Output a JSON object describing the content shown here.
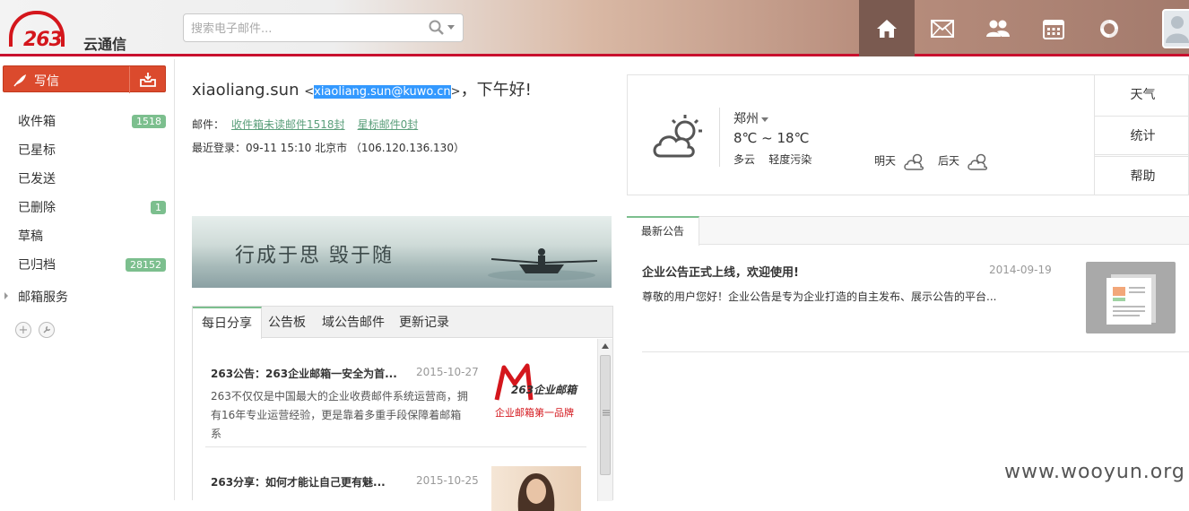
{
  "app": {
    "logo_number": "263",
    "logo_text": "云通信"
  },
  "search": {
    "placeholder": "搜索电子邮件..."
  },
  "nav": [
    {
      "icon": "home-icon",
      "active": true
    },
    {
      "icon": "mail-icon"
    },
    {
      "icon": "contacts-icon"
    },
    {
      "icon": "calendar-icon"
    },
    {
      "icon": "refresh-icon"
    }
  ],
  "sidebar": {
    "compose_label": "写信",
    "folders": [
      {
        "name": "收件箱",
        "badge": "1518"
      },
      {
        "name": "已星标",
        "badge": ""
      },
      {
        "name": "已发送",
        "badge": ""
      },
      {
        "name": "已删除",
        "badge": "1"
      },
      {
        "name": "草稿",
        "badge": ""
      },
      {
        "name": "已归档",
        "badge": "28152"
      }
    ],
    "service_label": "邮箱服务"
  },
  "greeting": {
    "username": "xiaoliang.sun",
    "email_open": "<",
    "email": "xiaoliang.sun@kuwo.cn",
    "email_close": ">",
    "salutation": "，下午好!"
  },
  "mail_info": {
    "label": "邮件：",
    "unread_link": "收件箱未读邮件1518封",
    "starred_link": "星标邮件0封"
  },
  "last_login": "最近登录：09-11 15:10 北京市 （106.120.136.130）",
  "banner": {
    "slogan": "行成于思   毁于随"
  },
  "tabs": [
    "每日分享",
    "公告板",
    "域公告邮件",
    "更新记录"
  ],
  "news": [
    {
      "title": "263公告：263企业邮箱一安全为首...",
      "date": "2015-10-27",
      "body": "263不仅仅是中国最大的企业收费邮件系统运营商，拥有16年专业运营经验，更是靠着多重手段保障着邮箱系",
      "image_logo": "263企业邮箱",
      "image_sub": "企业邮箱第一品牌"
    },
    {
      "title": "263分享：如何才能让自己更有魅...",
      "date": "2015-10-25",
      "body": ""
    }
  ],
  "weather": {
    "city": "郑州",
    "temp": "8℃ ~ 18℃",
    "condition": "多云",
    "pollution": "轻度污染",
    "tomorrow": "明天",
    "after": "后天",
    "side": [
      "天气",
      "统计",
      "帮助"
    ]
  },
  "notice": {
    "tab": "最新公告",
    "title": "企业公告正式上线，欢迎使用!",
    "date": "2014-09-19",
    "body": "尊敬的用户您好！企业公告是专为企业打造的自主发布、展示公告的平台..."
  },
  "watermark": "www.wooyun.org",
  "colors": {
    "accent": "#db4a2d",
    "brand_red": "#d4161c",
    "badge_green": "#7cbf8e",
    "link_green": "#5a9e7a",
    "selection": "#3399ff"
  }
}
